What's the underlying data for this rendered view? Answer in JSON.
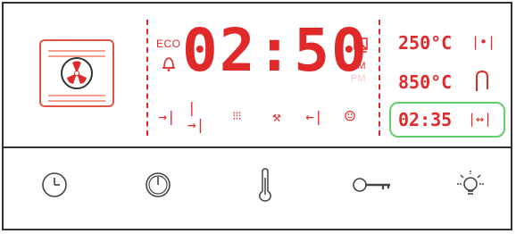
{
  "display": {
    "eco_label": "ECO",
    "main_time": "02:50",
    "am": "AM",
    "pm": "PM",
    "temp_set": "250°C",
    "temp_actual": "850°C",
    "timer": "02:35",
    "fn_icons": [
      "→|",
      "|→|",
      "⁝⁝⁝",
      "⚒",
      "←|",
      "☺"
    ]
  },
  "buttons": [
    "clock-button",
    "timer-button",
    "temperature-button",
    "key-lock-button",
    "light-button"
  ],
  "colors": {
    "digit_red": "#e02a2a",
    "faint_red": "#f1c9c4",
    "highlight_green": "#5fd06a",
    "outline": "#333333"
  }
}
